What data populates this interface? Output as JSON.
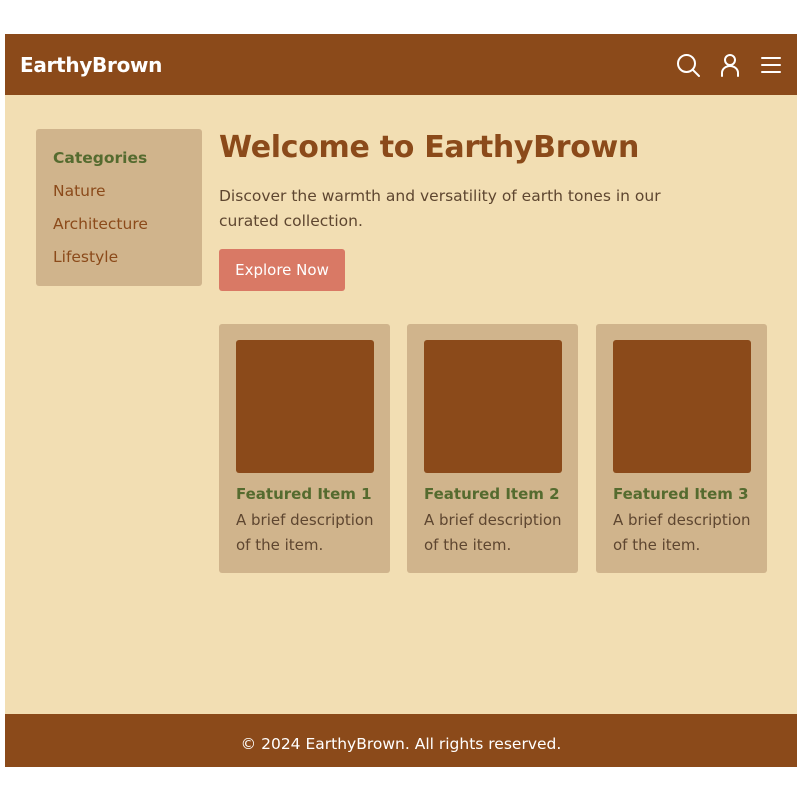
{
  "header": {
    "brand": "EarthyBrown",
    "icons": [
      "search-icon",
      "user-icon",
      "menu-icon"
    ]
  },
  "sidebar": {
    "heading": "Categories",
    "items": [
      {
        "label": "Nature"
      },
      {
        "label": "Architecture"
      },
      {
        "label": "Lifestyle"
      }
    ]
  },
  "main": {
    "title": "Welcome to EarthyBrown",
    "intro": "Discover the warmth and versatility of earth tones in our curated collection.",
    "cta_label": "Explore Now",
    "cards": [
      {
        "title": "Featured Item 1",
        "description": "A brief description of the item."
      },
      {
        "title": "Featured Item 2",
        "description": "A brief description of the item."
      },
      {
        "title": "Featured Item 3",
        "description": "A brief description of the item."
      }
    ]
  },
  "footer": {
    "text": "© 2024 EarthyBrown. All rights reserved."
  },
  "colors": {
    "primary_brown": "#8b4a1a",
    "background_beige": "#f2deb3",
    "panel_tan": "#d0b48c",
    "accent_green": "#556b2f",
    "button_terracotta": "#d97965"
  }
}
